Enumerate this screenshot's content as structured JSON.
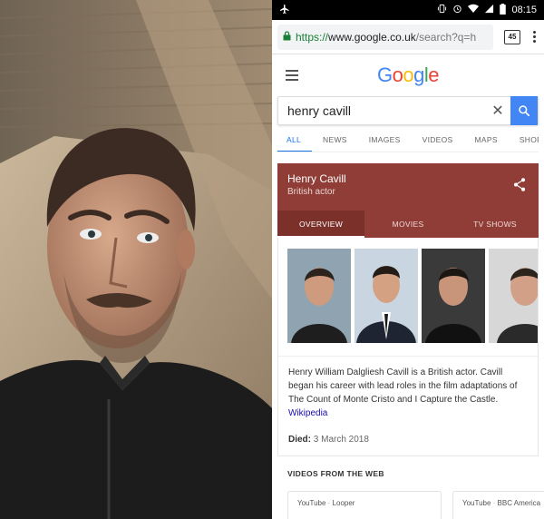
{
  "status_bar": {
    "time": "08:15",
    "icons": [
      "airplane-mode-icon",
      "vibrate-icon",
      "alarm-icon",
      "wifi-icon",
      "signal-icon",
      "battery-icon"
    ]
  },
  "browser": {
    "url_scheme": "https://",
    "url_host": "www.google.co.uk",
    "url_path": "/search?q=h",
    "tabs_count": "45"
  },
  "google": {
    "logo": "Google",
    "logo_colors": [
      "#4285F4",
      "#EA4335",
      "#FBBC05",
      "#4285F4",
      "#34A853",
      "#EA4335"
    ],
    "search_query": "henry cavill",
    "tabs": [
      "ALL",
      "NEWS",
      "IMAGES",
      "VIDEOS",
      "MAPS",
      "SHOPPI"
    ],
    "active_tab": "ALL"
  },
  "knowledge_panel": {
    "name": "Henry Cavill",
    "subtitle": "British actor",
    "header_color": "#8f3d36",
    "tabs": [
      "OVERVIEW",
      "MOVIES",
      "TV SHOWS"
    ],
    "active_tab": "OVERVIEW",
    "description": "Henry William Dalgliesh Cavill is a British actor. Cavill began his career with lead roles in the film adaptations of The Count of Monte Cristo and I Capture the Castle.",
    "source_link": "Wikipedia",
    "died_label": "Died:",
    "died_value": "3 March 2018"
  },
  "videos_from_web": {
    "title": "VIDEOS FROM THE WEB",
    "cards": [
      {
        "source": "YouTube",
        "channel": "Looper"
      },
      {
        "source": "YouTube",
        "channel": "BBC America"
      }
    ]
  }
}
